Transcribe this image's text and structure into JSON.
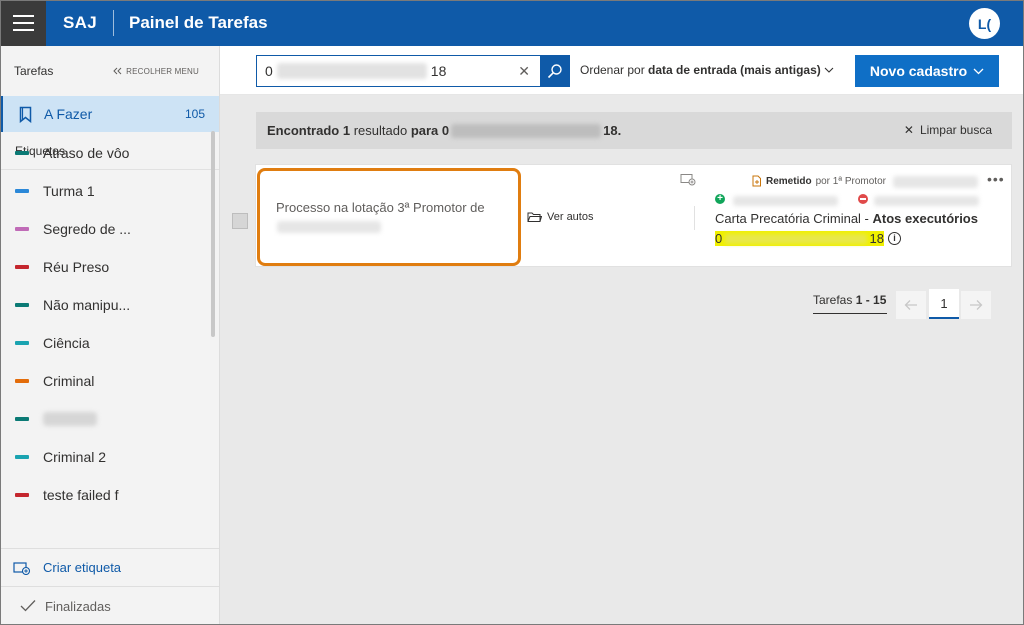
{
  "header": {
    "brand": "SAJ",
    "title": "Painel de Tarefas",
    "user_initials": "L("
  },
  "sidebar": {
    "section_title": "Tarefas",
    "collapse_label": "RECOLHER MENU",
    "active_item": {
      "label": "A Fazer",
      "count": "105"
    },
    "labels_title": "Etiquetas",
    "tags": [
      {
        "label": "Atraso de vôo",
        "color": "#0b7a75"
      },
      {
        "label": "Turma 1",
        "color": "#2b88d8"
      },
      {
        "label": "Segredo de ...",
        "color": "#c06bb7"
      },
      {
        "label": "Réu Preso",
        "color": "#c4262e"
      },
      {
        "label": "Não manipu...",
        "color": "#0b7a75"
      },
      {
        "label": "Ciência",
        "color": "#1aa3b0"
      },
      {
        "label": "Criminal",
        "color": "#e36c0a"
      },
      {
        "label": "",
        "color": "#0b7a75"
      },
      {
        "label": "Criminal 2",
        "color": "#1aa3b0"
      },
      {
        "label": "teste failed f",
        "color": "#c4262e"
      }
    ],
    "create_label": "Criar etiqueta",
    "finished_label": "Finalizadas"
  },
  "commandbar": {
    "search_prefix": "0",
    "search_suffix": "18",
    "order_prefix": "Ordenar por",
    "order_value": "data de entrada (mais antigas)",
    "new_button": "Novo cadastro"
  },
  "results": {
    "found": "Encontrado",
    "count": "1",
    "result_word": "resultado",
    "para": "para",
    "query_prefix": "0",
    "query_suffix": "18.",
    "clear_label": "Limpar busca"
  },
  "task": {
    "location_text": "Processo na lotação 3ª Promotor de",
    "open_files": "Ver autos",
    "sent_label": "Remetido",
    "sent_by": "por 1ª Promotor",
    "class_name": "Carta Precatória Criminal",
    "class_subject": "Atos executórios",
    "case_prefix": "0",
    "case_suffix": "18",
    "highlight_color": "#f0f000"
  },
  "pagination": {
    "label": "Tarefas",
    "range": "1 - 15",
    "current_page": "1"
  },
  "colors": {
    "topbar": "#0f5aa8",
    "accent": "#0f6fc6",
    "focus_outline": "#e07d10"
  }
}
